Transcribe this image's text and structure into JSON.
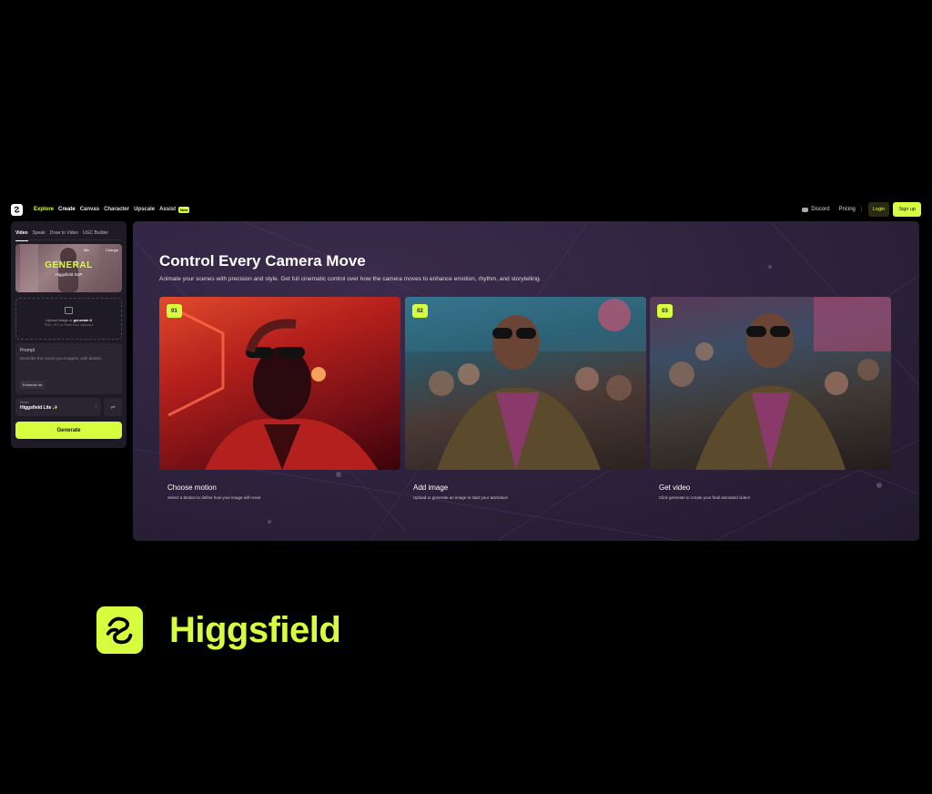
{
  "nav": {
    "links": [
      "Explore",
      "Create",
      "Canvas",
      "Character",
      "Upscale",
      "Assist"
    ],
    "new_badge": "New",
    "discord": "Discord",
    "pricing": "Pricing",
    "login": "Login",
    "signup": "Sign up"
  },
  "sidebar": {
    "tabs": [
      "Video",
      "Speak",
      "Draw to Video",
      "UGC Builder"
    ],
    "preset": {
      "title": "GENERAL",
      "subtitle": "Higgsfield DoP",
      "mix": "Mix",
      "change": "Change"
    },
    "upload": {
      "prefix": "Upload image or ",
      "link": "generate it",
      "formats": "PNG, JPG or Paste from clipboard"
    },
    "prompt": {
      "label": "Prompt",
      "placeholder": "Describe the scene you imagine, with details.",
      "enhance": "Enhance on"
    },
    "model": {
      "label": "Model",
      "value": "Higgsfield Lite ✨"
    },
    "generate": "Generate"
  },
  "main": {
    "title": "Control Every Camera Move",
    "subtitle": "Animate your scenes with precision and style. Get full cinematic control over how the camera moves to enhance emotion, rhythm, and storytelling.",
    "steps": [
      {
        "num": "01",
        "title": "Choose motion",
        "desc": "Select a Motion to define how your image will move"
      },
      {
        "num": "02",
        "title": "Add image",
        "desc": "Upload or generate an image to start your animation"
      },
      {
        "num": "03",
        "title": "Get video",
        "desc": "Click generate to create your final animated video!"
      }
    ]
  },
  "brand": {
    "name": "Higgsfield"
  },
  "colors": {
    "accent": "#d7fd3f",
    "background": "#000000",
    "panel": "#2f2440"
  }
}
